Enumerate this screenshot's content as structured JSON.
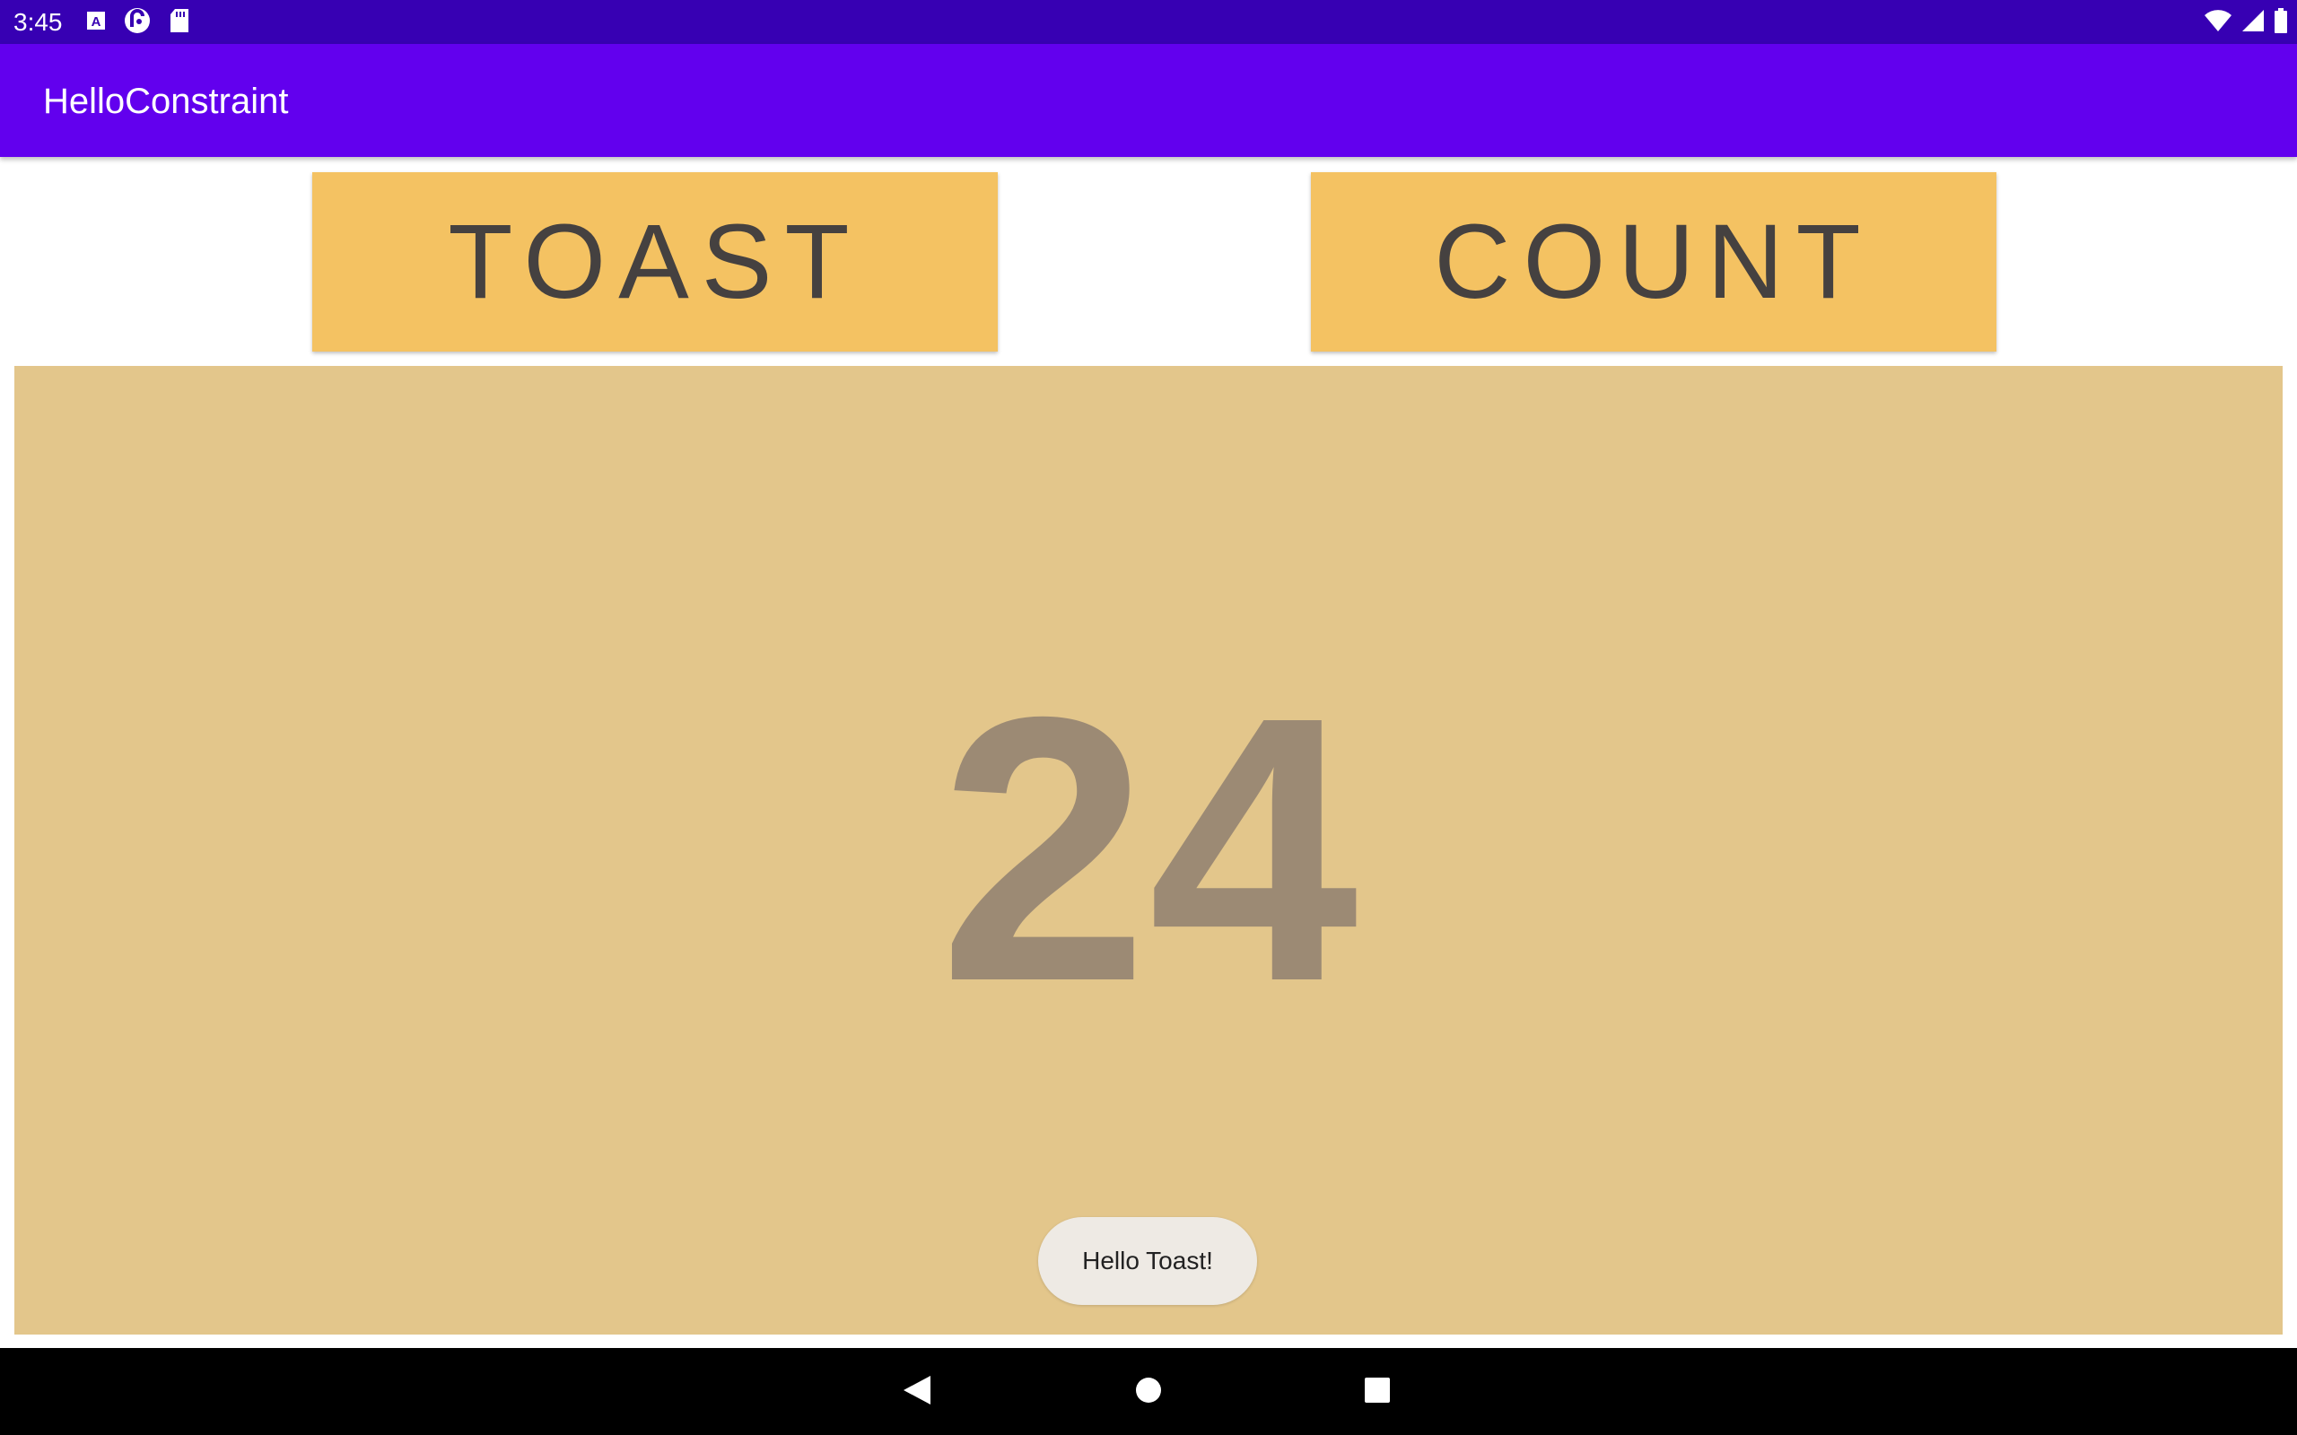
{
  "status_bar": {
    "time": "3:45",
    "left_icons": [
      "a-notification-icon",
      "pocket-casts-icon",
      "sd-card-icon"
    ],
    "right_icons": [
      "wifi-icon",
      "cell-signal-icon",
      "battery-icon"
    ]
  },
  "app_bar": {
    "title": "HelloConstraint",
    "background": "#6200ee"
  },
  "buttons": {
    "toast_label": "TOAST",
    "count_label": "COUNT",
    "background": "#f4c262"
  },
  "counter": {
    "value": "24",
    "background": "#e3c68b"
  },
  "toast_message": {
    "text": "Hello Toast!"
  },
  "nav_bar": {
    "icons": [
      "back-icon",
      "home-icon",
      "recents-icon"
    ]
  }
}
